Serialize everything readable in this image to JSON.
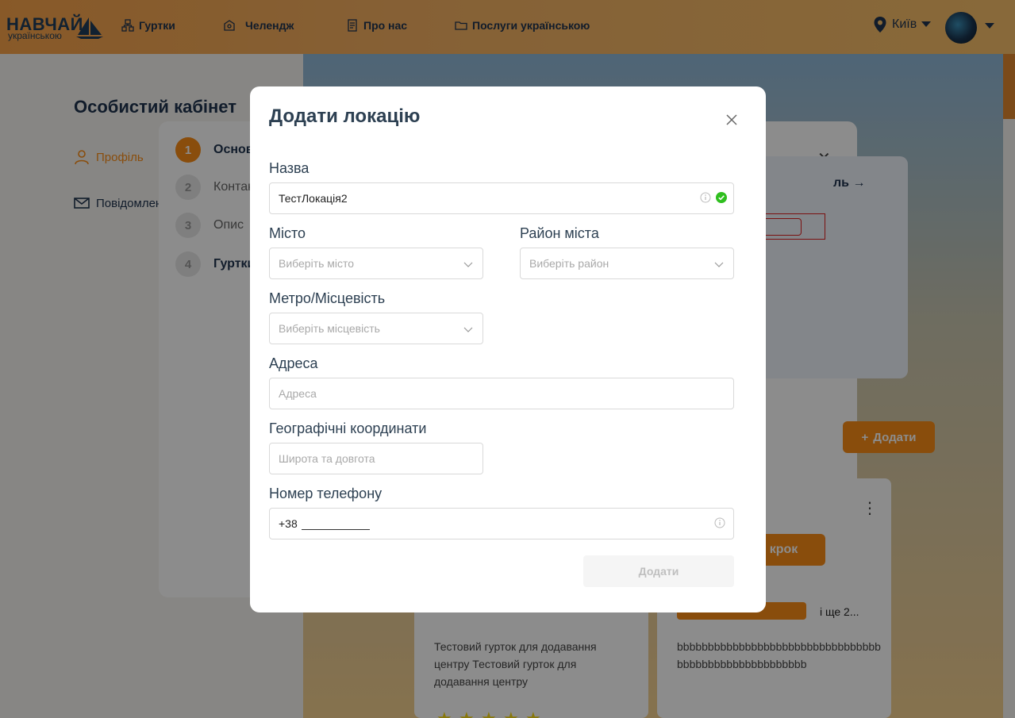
{
  "header": {
    "logo_text": "НАВЧАЙ",
    "logo_subtext": "українською",
    "nav": [
      {
        "label": "Гуртки",
        "icon": "clubs-icon"
      },
      {
        "label": "Челендж",
        "icon": "challenge-icon"
      },
      {
        "label": "Про нас",
        "icon": "about-icon"
      },
      {
        "label": "Послуги українською",
        "icon": "services-icon"
      }
    ],
    "city": "Київ"
  },
  "sidebar": {
    "title": "Особистий кабінет",
    "items": [
      {
        "label": "Профіль",
        "icon": "user-icon"
      },
      {
        "label": "Повідомлення",
        "icon": "mail-icon"
      }
    ]
  },
  "wizard": {
    "steps": [
      {
        "num": "1",
        "label": "Основна інформація"
      },
      {
        "num": "2",
        "label": "Контакти"
      },
      {
        "num": "3",
        "label": "Опис"
      },
      {
        "num": "4",
        "label": "Гуртки"
      }
    ],
    "profile_link": "ль",
    "next_label": "крок",
    "add_label": "Додати"
  },
  "cards": {
    "card1_text": "Тестовий гурток для додавання центру Тестовий гурток для додавання центру",
    "card2_text": "bbbbbbbbbbbbbbbbbbbbbbbbbbbbbbbbbbbbbbbbbbbbbbbbbbbbbb",
    "card2_more": "і ще 2..."
  },
  "modal": {
    "title": "Додати локацію",
    "fields": {
      "name": {
        "label": "Назва",
        "value": "ТестЛокація2"
      },
      "city": {
        "label": "Місто",
        "placeholder": "Виберіть місто"
      },
      "district": {
        "label": "Район міста",
        "placeholder": "Виберіть район"
      },
      "metro": {
        "label": "Метро/Місцевість",
        "placeholder": "Виберіть місцевість"
      },
      "address": {
        "label": "Адреса",
        "placeholder": "Адреса"
      },
      "coords": {
        "label": "Географічні координати",
        "placeholder": "Широта та довгота"
      },
      "phone": {
        "label": "Номер телефону",
        "value": "+38"
      }
    },
    "submit_label": "Додати"
  },
  "colors": {
    "accent": "#fa8c16",
    "success": "#2fbf1f",
    "text_dark": "#2d4052"
  }
}
